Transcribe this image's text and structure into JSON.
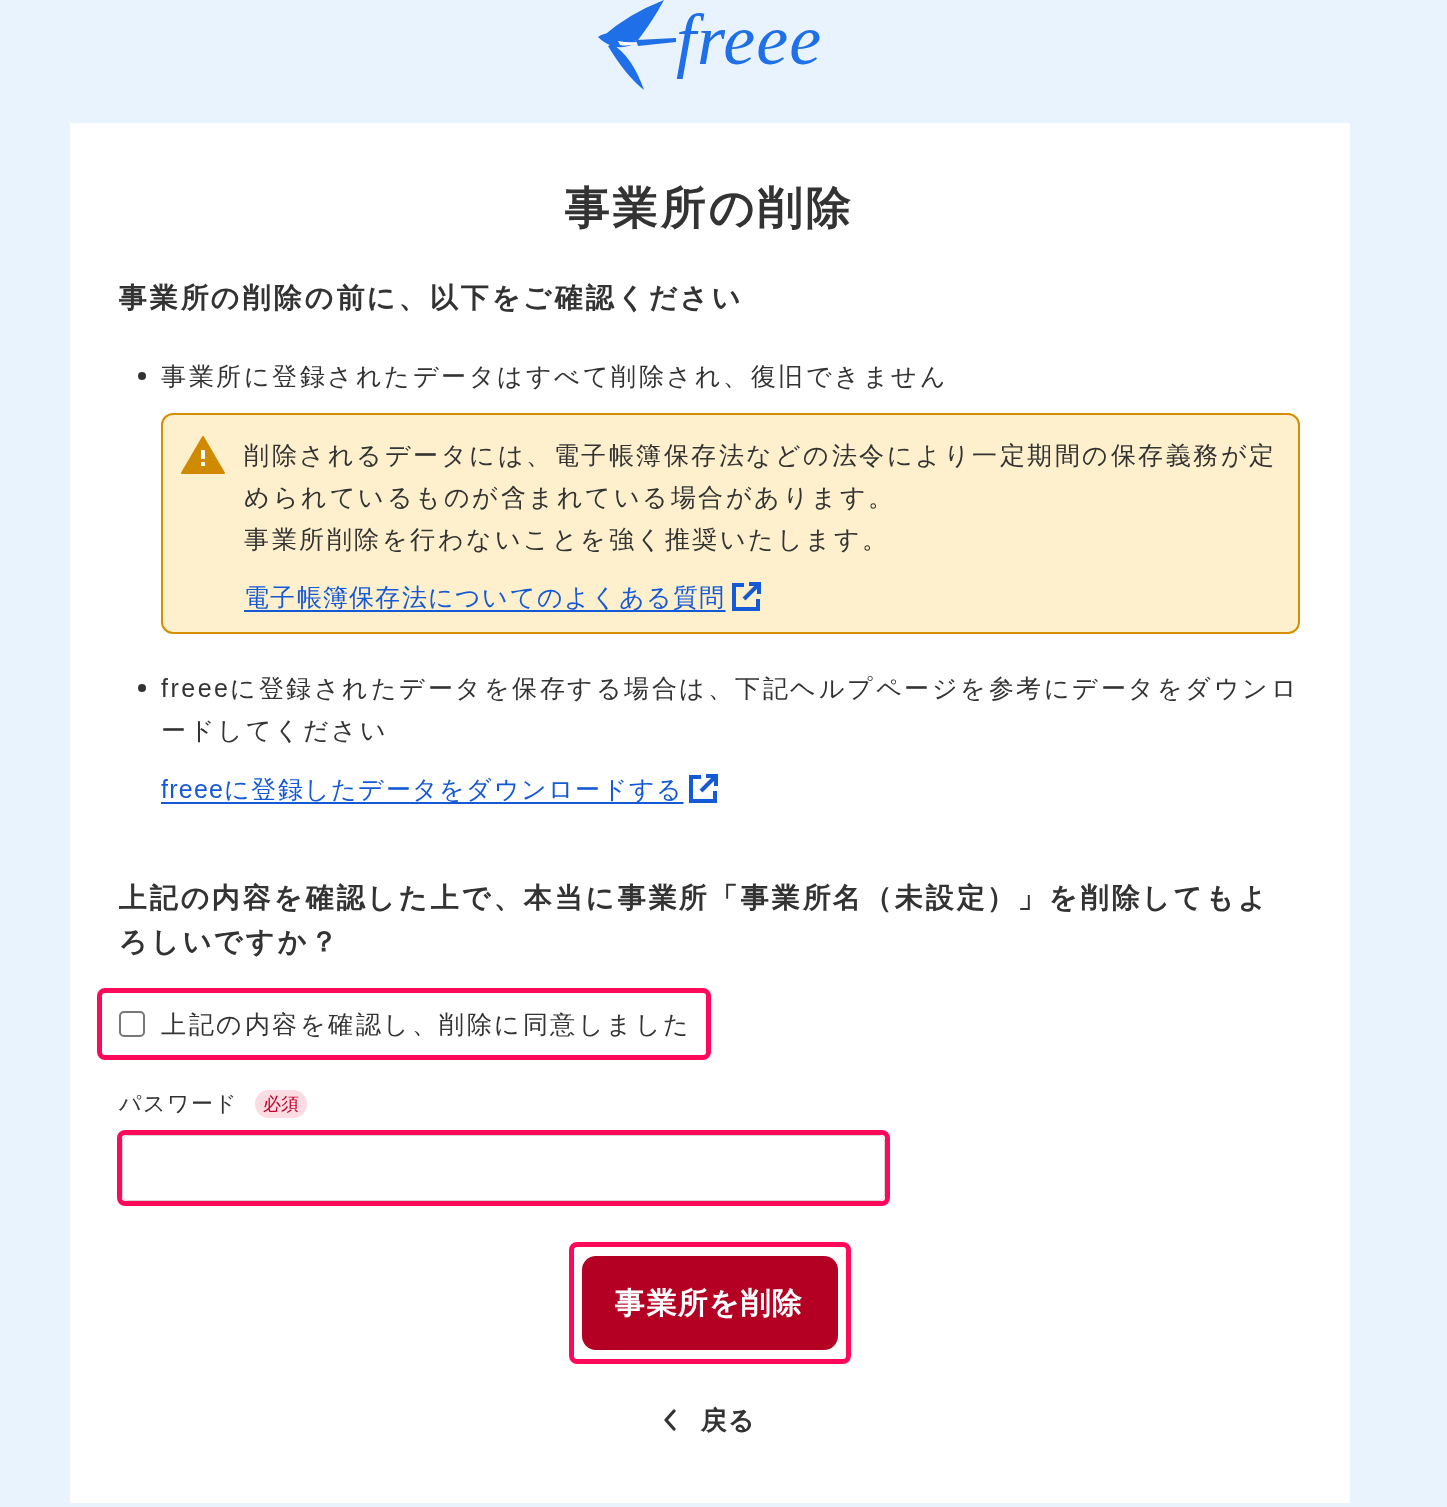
{
  "logo": {
    "wordmark": "freee"
  },
  "title": "事業所の削除",
  "notice": {
    "heading": "事業所の削除の前に、以下をご確認ください",
    "items": [
      {
        "text": "事業所に登録されたデータはすべて削除され、復旧できません",
        "alert": {
          "lines": [
            "削除されるデータには、電子帳簿保存法などの法令により一定期間の保存義務が定められているものが含まれている場合があります。",
            "事業所削除を行わないことを強く推奨いたします。"
          ],
          "link": "電子帳簿保存法についてのよくある質問"
        }
      },
      {
        "text": "freeeに登録されたデータを保存する場合は、下記ヘルプページを参考にデータをダウンロードしてください",
        "link": "freeeに登録したデータをダウンロードする"
      }
    ]
  },
  "confirm": {
    "question": "上記の内容を確認した上で、本当に事業所「事業所名（未設定）」を削除してもよろしいですか？",
    "checkbox": {
      "label": "上記の内容を確認し、削除に同意しました",
      "checked": false,
      "highlighted": true
    }
  },
  "password": {
    "label": "パスワード",
    "badge": "必須",
    "highlighted": true
  },
  "delete_button": {
    "label": "事業所を削除",
    "highlighted": true
  },
  "back_link": {
    "label": "戻る"
  }
}
